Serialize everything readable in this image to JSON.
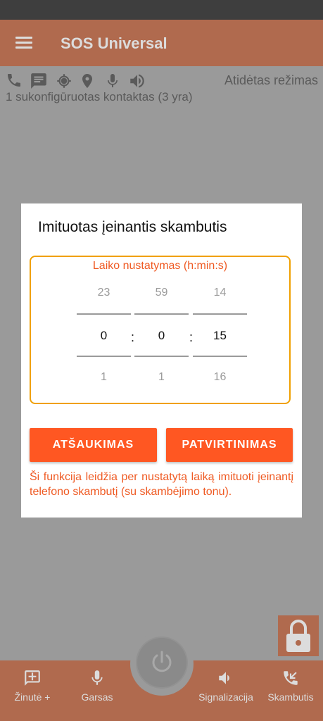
{
  "app": {
    "title": "SOS Universal"
  },
  "status": {
    "icons": [
      "phone-icon",
      "message-icon",
      "gps-icon",
      "location-pin-icon",
      "microphone-icon",
      "speaker-icon"
    ],
    "mode": "Atidėtas režimas",
    "contacts_text": "1 sukonfigūruotas kontaktas (3 yra)"
  },
  "dialog": {
    "title": "Imituotas įeinantis skambutis",
    "picker_heading": "Laiko nustatymas (h:min:s)",
    "hours": {
      "prev": "23",
      "current": "0",
      "next": "1"
    },
    "minutes": {
      "prev": "59",
      "current": "0",
      "next": "1"
    },
    "seconds": {
      "prev": "14",
      "current": "15",
      "next": "16"
    },
    "separator": ":",
    "cancel_label": "ATŠAUKIMAS",
    "confirm_label": "PATVIRTINIMAS",
    "description": "Ši funkcija leidžia per nustatytą laiką imituoti įeinantį telefono skambutį (su skambėjimo tonu)."
  },
  "bottom_nav": {
    "note_label": "Žinutė +",
    "sound_label": "Garsas",
    "signal_label": "Signalizacija",
    "calls_label": "Skambutis"
  },
  "colors": {
    "accent": "#ff5722",
    "picker_border": "#f0a000",
    "dim_toolbar": "#b06a4e",
    "overlay_bg": "#9a9a9a"
  }
}
